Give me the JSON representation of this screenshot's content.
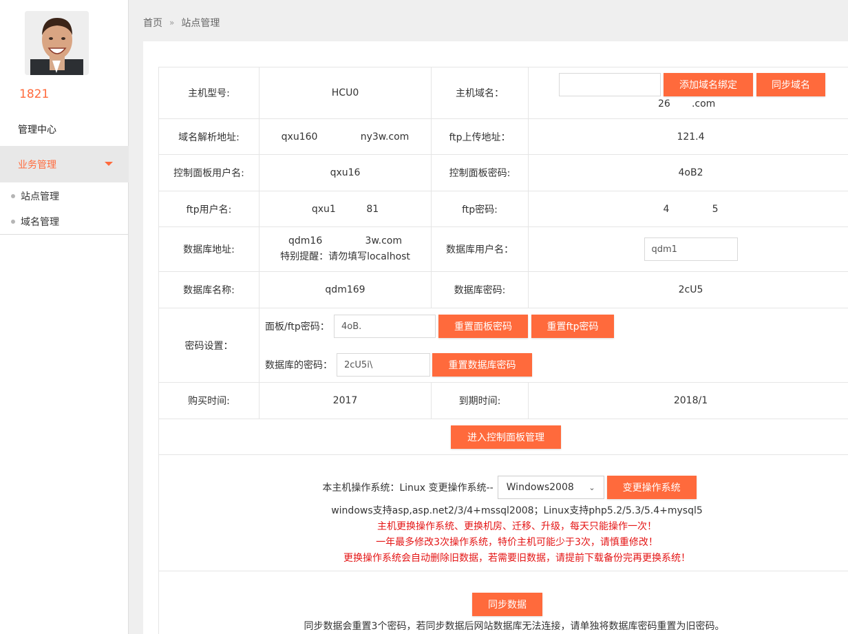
{
  "sidebar": {
    "username": "1821",
    "management_center": "管理中心",
    "active_section": "业务管理",
    "subitems": [
      "站点管理",
      "域名管理"
    ]
  },
  "breadcrumb": {
    "home": "首页",
    "separator": "»",
    "current": "站点管理"
  },
  "host": {
    "model_label": "主机型号:",
    "model_value": "HCU0",
    "domain_label": "主机域名：",
    "domain_input": "",
    "add_domain_button": "添加域名绑定",
    "sync_domain_button": "同步域名",
    "domain_value": "26       .com",
    "resolve_label": "域名解析地址:",
    "resolve_value": "qxu160              ny3w.com",
    "ftp_upload_label": "ftp上传地址：",
    "ftp_upload_value": "121.4",
    "panel_user_label": "控制面板用户名:",
    "panel_user_value": "qxu16",
    "panel_pwd_label": "控制面板密码:",
    "panel_pwd_value": "4oB2",
    "ftp_user_label": "ftp用户名:",
    "ftp_user_value": "qxu1          81",
    "ftp_pwd_label": "ftp密码:",
    "ftp_pwd_value": "4              5",
    "db_addr_label": "数据库地址:",
    "db_addr_value": "qdm16              3w.com",
    "db_addr_note": "特别提醒：请勿填写localhost",
    "db_user_label": "数据库用户名：",
    "db_user_value": "qdm1",
    "db_name_label": "数据库名称:",
    "db_name_value": "qdm169",
    "db_pwd_label": "数据库密码:",
    "db_pwd_value": "2cU5",
    "pwd_settings_label": "密码设置：",
    "panel_ftp_pwd_label": "面板/ftp密码：",
    "panel_ftp_pwd_input": "4oB.",
    "reset_panel_pwd_button": "重置面板密码",
    "reset_ftp_pwd_button": "重置ftp密码",
    "db_pwd_set_label": "数据库的密码：",
    "db_pwd_input": "2cU5i\\",
    "reset_db_pwd_button": "重置数据库密码",
    "buy_time_label": "购买时间:",
    "buy_time_value": "2017",
    "expire_label": "到期时间:",
    "expire_value": "2018/1",
    "enter_panel_button": "进入控制面板管理"
  },
  "os": {
    "current_text": "本主机操作系统：Linux 变更操作系统--",
    "selected_os": "Windows2008",
    "change_button": "变更操作系统",
    "support_text": "windows支持asp,asp.net2/3/4+mssql2008；Linux支持php5.2/5.3/5.4+mysql5",
    "warning1": "主机更换操作系统、更换机房、迁移、升级，每天只能操作一次！",
    "warning2": "一年最多修改3次操作系统，特价主机可能少于3次，请慎重修改！",
    "warning3": "更换操作系统会自动删除旧数据，若需要旧数据，请提前下载备份完再更换系统！"
  },
  "sync": {
    "button": "同步数据",
    "note": "同步数据会重置3个密码，若同步数据后网站数据库无法连接，请单独将数据库密码重置为旧密码。"
  },
  "colors": {
    "accent": "#ff6a3c",
    "warning": "#e41515"
  }
}
